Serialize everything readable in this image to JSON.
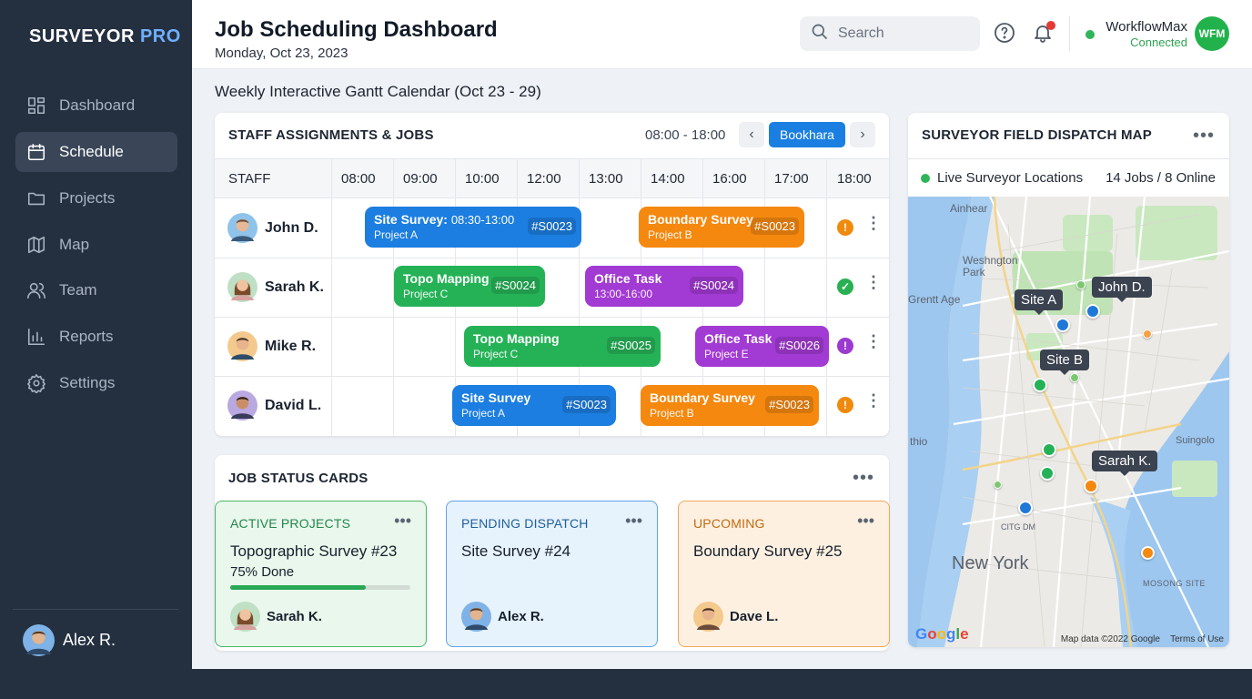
{
  "sidebar": {
    "brand_main": "SURVEYOR",
    "brand_accent": "PRO",
    "items": [
      {
        "label": "Dashboard",
        "icon": "dashboard-icon"
      },
      {
        "label": "Schedule",
        "icon": "calendar-icon",
        "active": true
      },
      {
        "label": "Projects",
        "icon": "folder-icon"
      },
      {
        "label": "Map",
        "icon": "map-icon"
      },
      {
        "label": "Team",
        "icon": "team-icon"
      },
      {
        "label": "Reports",
        "icon": "bar-chart-icon"
      },
      {
        "label": "Settings",
        "icon": "gear-icon"
      }
    ],
    "user": "Alex R."
  },
  "header": {
    "title": "Job Scheduling Dashboard",
    "date": "Monday, Oct 23, 2023",
    "search_placeholder": "Search",
    "integration_name": "WorkflowMax",
    "integration_status": "Connected",
    "integration_badge": "WFM"
  },
  "subtitle": "Weekly Interactive Gantt Calendar (Oct 23 - 29)",
  "gantt": {
    "title": "STAFF ASSIGNMENTS & JOBS",
    "time_range": "08:00 - 18:00",
    "prev": "‹",
    "next": "›",
    "location": "Bookhara",
    "staff_header": "STAFF",
    "columns": [
      "08:00",
      "09:00",
      "10:00",
      "12:00",
      "13:00",
      "14:00",
      "16:00",
      "17:00",
      "18:00"
    ],
    "rows": [
      {
        "name": "John D.",
        "status": "!",
        "jobs": [
          {
            "title": "Site Survey:",
            "time": "08:30-13:00",
            "sub": "Project A",
            "code": "#S0023",
            "color": "blue"
          },
          {
            "title": "Boundary Survey",
            "time": "",
            "sub": "Project B",
            "code": "#S0023",
            "color": "orange"
          }
        ]
      },
      {
        "name": "Sarah K.",
        "status": "✓",
        "jobs": [
          {
            "title": "Topo Mapping",
            "time": "",
            "sub": "Project C",
            "code": "#S0024",
            "color": "green"
          },
          {
            "title": "Office Task",
            "time": "",
            "sub": "13:00-16:00",
            "code": "#S0024",
            "color": "purple"
          }
        ]
      },
      {
        "name": "Mike R.",
        "status": "!",
        "jobs": [
          {
            "title": "Topo Mapping",
            "time": "",
            "sub": "Project C",
            "code": "#S0025",
            "color": "green"
          },
          {
            "title": "Office Task",
            "time": "",
            "sub": "Project E",
            "code": "#S0026",
            "color": "purple"
          }
        ]
      },
      {
        "name": "David L.",
        "status": "!",
        "jobs": [
          {
            "title": "Site Survey",
            "time": "",
            "sub": "Project A",
            "code": "#S0023",
            "color": "blue"
          },
          {
            "title": "Boundary Survey",
            "time": "",
            "sub": "Project B",
            "code": "#S0023",
            "color": "orange"
          }
        ]
      }
    ]
  },
  "job_status": {
    "title": "JOB STATUS CARDS",
    "cards": [
      {
        "label": "ACTIVE PROJECTS",
        "name": "Topographic Survey #23",
        "progress_text": "75% Done",
        "progress": 0.75,
        "assignee": "Sarah K."
      },
      {
        "label": "PENDING DISPATCH",
        "name": "Site Survey #24",
        "assignee": "Alex R."
      },
      {
        "label": "UPCOMING",
        "name": "Boundary Survey #25",
        "assignee": "Dave L."
      }
    ]
  },
  "map": {
    "title": "SURVEYOR FIELD DISPATCH MAP",
    "live_label": "Live Surveyor Locations",
    "summary": "14 Jobs / 8 Online",
    "pins": [
      "Site A",
      "John D.",
      "Site B",
      "Sarah K."
    ],
    "places": [
      "Ainhear",
      "Weshngton Park",
      "Grentt Age",
      "thio",
      "Suingolo",
      "CITG DM",
      "New York",
      "MOSONG SITE"
    ],
    "attribution": "Map data ©2022 Google",
    "terms": "Terms of Use",
    "logo": "Google"
  },
  "colors": {
    "blue": "#1c7ee0",
    "orange": "#f5880f",
    "green": "#25b257",
    "purple": "#a23ad4",
    "sidebar": "#243040"
  }
}
